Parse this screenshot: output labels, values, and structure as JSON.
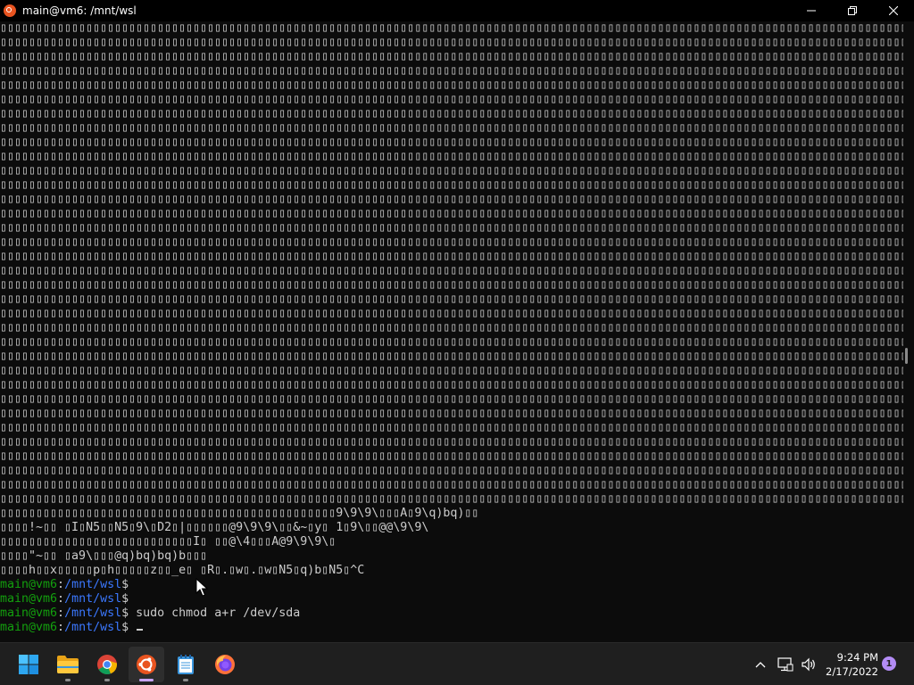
{
  "window": {
    "title": "main@vm6: /mnt/wsl",
    "controls": [
      "minimize-icon",
      "restore-icon",
      "close-icon"
    ]
  },
  "terminal": {
    "garbage_line": "▯▯▯▯▯▯▯▯▯▯▯▯▯▯▯▯▯▯▯▯▯▯▯▯▯▯▯▯▯▯▯▯▯▯▯▯▯▯▯▯▯▯▯▯▯▯▯▯▯▯▯▯▯▯▯▯▯▯▯▯▯▯▯▯▯▯▯▯▯▯▯▯▯▯▯▯▯▯▯▯▯▯▯▯▯▯▯▯▯▯▯▯▯▯▯▯▯▯▯▯▯▯▯▯▯▯▯▯▯▯▯▯▯▯▯▯▯▯▯▯▯▯▯▯▯▯▯▯▯▯▯▯▯▯▯",
    "garbage_line_count": 34,
    "tail_lines": [
      "▯▯▯▯▯▯▯▯▯▯▯▯▯▯▯▯▯▯▯▯▯▯▯▯▯▯▯▯▯▯▯▯▯▯▯▯▯▯▯▯▯▯▯▯▯▯▯9\\9\\9\\▯▯▯A▯9\\q)bq)▯▯",
      "▯▯▯▯!~▯▯ ▯I▯N5▯▯N5▯9\\▯D2▯|▯▯▯▯▯▯@9\\9\\9\\▯▯&~▯y▯ 1▯9\\▯▯@@\\9\\9\\",
      "▯▯▯▯▯▯▯▯▯▯▯▯▯▯▯▯▯▯▯▯▯▯▯▯▯▯▯I▯ ▯▯@\\4▯▯▯A@9\\9\\9\\▯",
      "▯▯▯▯\"~▯▯ ▯a9\\▯▯▯@q)bq)bq)b▯▯▯",
      "▯▯▯▯h▯▯x▯▯▯▯▯p▯h▯▯▯▯▯z▯▯_e▯ ▯R▯.▯w▯.▯w▯N5▯q)b▯N5▯^C"
    ],
    "prompt": {
      "user_host": "main@vm6",
      "separator": ":",
      "path": "/mnt/wsl",
      "symbol": "$"
    },
    "commands": [
      "",
      "",
      "sudo chmod a+r /dev/sda",
      ""
    ]
  },
  "taskbar": {
    "apps": [
      {
        "name": "start-icon",
        "running": false,
        "active": false
      },
      {
        "name": "file-explorer-icon",
        "running": true,
        "active": false
      },
      {
        "name": "chrome-icon",
        "running": true,
        "active": false
      },
      {
        "name": "ubuntu-icon",
        "running": true,
        "active": true
      },
      {
        "name": "notepad-icon",
        "running": true,
        "active": false
      },
      {
        "name": "firefox-icon",
        "running": false,
        "active": false
      }
    ],
    "tray": {
      "time": "9:24 PM",
      "date": "2/17/2022",
      "notification_count": "1"
    }
  },
  "colors": {
    "terminal_bg": "#0c0c0c",
    "terminal_fg": "#cccccc",
    "prompt_user": "#13a10e",
    "prompt_path": "#3b78ff",
    "taskbar_bg": "#1f1f1f",
    "ubuntu_orange": "#e95420",
    "accent_indicator": "#c9a5ff"
  }
}
